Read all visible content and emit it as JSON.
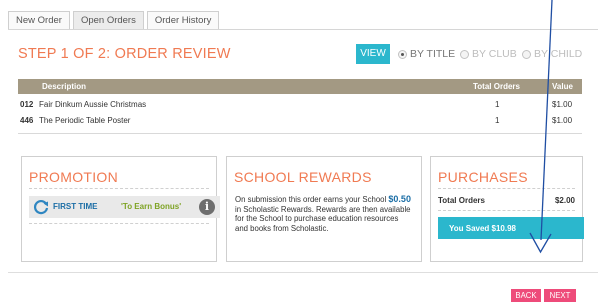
{
  "tabs": [
    {
      "label": "New Order",
      "active": false
    },
    {
      "label": "Open Orders",
      "active": true
    },
    {
      "label": "Order History",
      "active": false
    }
  ],
  "step_title": "STEP 1 OF 2: ORDER REVIEW",
  "view": {
    "button_label": "VIEW",
    "options": [
      {
        "label": "BY TITLE",
        "checked": true
      },
      {
        "label": "BY CLUB",
        "checked": false
      },
      {
        "label": "BY CHILD",
        "checked": false
      }
    ]
  },
  "table": {
    "headers": {
      "description": "Description",
      "total_orders": "Total Orders",
      "value": "Value"
    },
    "rows": [
      {
        "code": "012",
        "description": "Fair Dinkum Aussie Christmas",
        "total_orders": "1",
        "value": "$1.00"
      },
      {
        "code": "446",
        "description": "The Periodic Table Poster",
        "total_orders": "1",
        "value": "$1.00"
      }
    ]
  },
  "promotion": {
    "title": "PROMOTION",
    "first_time": "FIRST TIME",
    "bonus_text": "'To Earn Bonus'",
    "info_symbol": "i"
  },
  "rewards": {
    "title": "SCHOOL REWARDS",
    "text_before": "On submission this order earns your School ",
    "amount": "$0.50",
    "text_after": " in Scholastic Rewards. Rewards are then available for the School to purchase education resources and books from Scholastic."
  },
  "purchases": {
    "title": "PURCHASES",
    "total_label": "Total Orders",
    "total_value": "$2.00",
    "saved_text": "You Saved $10.98"
  },
  "footer": {
    "back_label": "BACK",
    "next_label": "NEXT"
  },
  "colors": {
    "accent_orange": "#f07a52",
    "teal": "#2bb7cd",
    "table_header": "#a39983",
    "button_pink": "#ee4b7a",
    "arrow_blue": "#1f4ea3"
  },
  "icons": {
    "promo": "refresh-arrow-icon",
    "info": "info-icon"
  }
}
